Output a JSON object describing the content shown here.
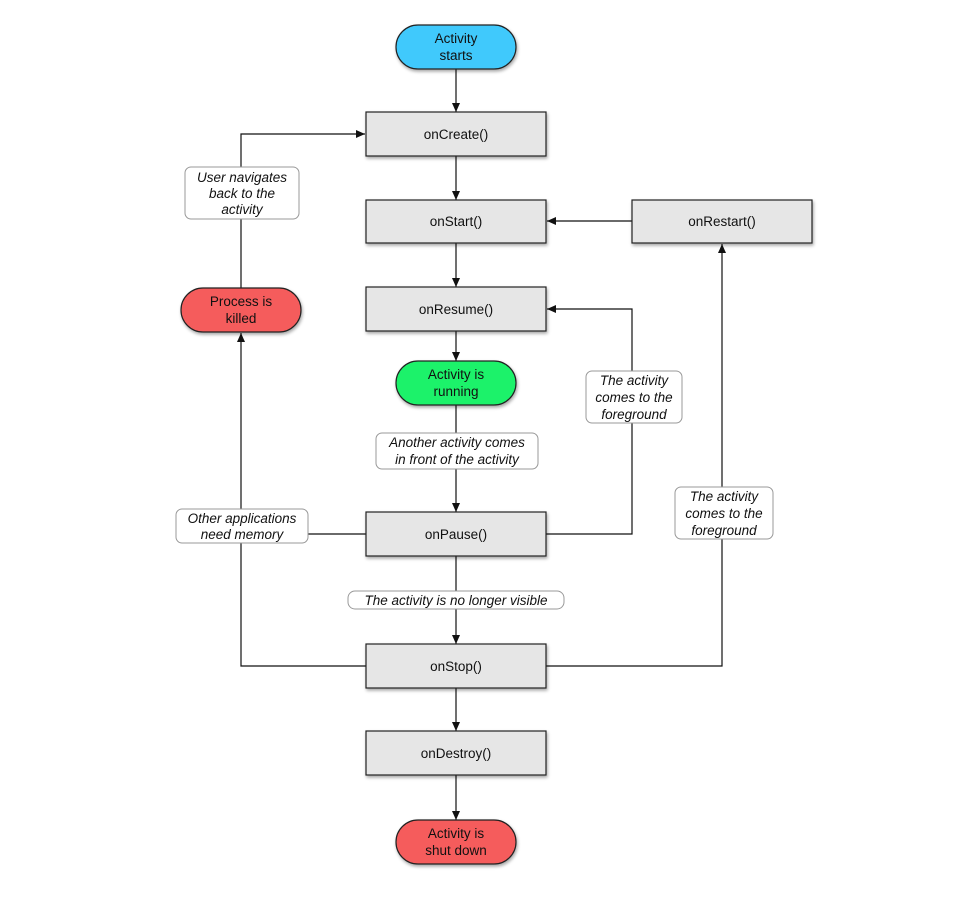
{
  "colors": {
    "start": "#3fc9fc",
    "running": "#1af26b",
    "terminal": "#f55b5b",
    "callback": "#e6e6e6"
  },
  "nodes": {
    "activity_starts": [
      "Activity",
      "starts"
    ],
    "on_create": "onCreate()",
    "on_start": "onStart()",
    "on_restart": "onRestart()",
    "on_resume": "onResume()",
    "activity_running": [
      "Activity is",
      "running"
    ],
    "on_pause": "onPause()",
    "on_stop": "onStop()",
    "on_destroy": "onDestroy()",
    "activity_shut_down": [
      "Activity is",
      "shut down"
    ],
    "process_killed": [
      "Process is",
      "killed"
    ]
  },
  "edge_labels": {
    "user_navigates_back": [
      "User navigates",
      "back to the",
      "activity"
    ],
    "foreground_to_resume": [
      "The activity",
      "comes to the",
      "foreground"
    ],
    "another_activity": [
      "Another activity comes",
      "in front of the activity"
    ],
    "other_apps_memory": [
      "Other applications",
      "need memory"
    ],
    "foreground_to_restart": [
      "The activity",
      "comes to the",
      "foreground"
    ],
    "no_longer_visible": "The activity is no longer visible"
  }
}
